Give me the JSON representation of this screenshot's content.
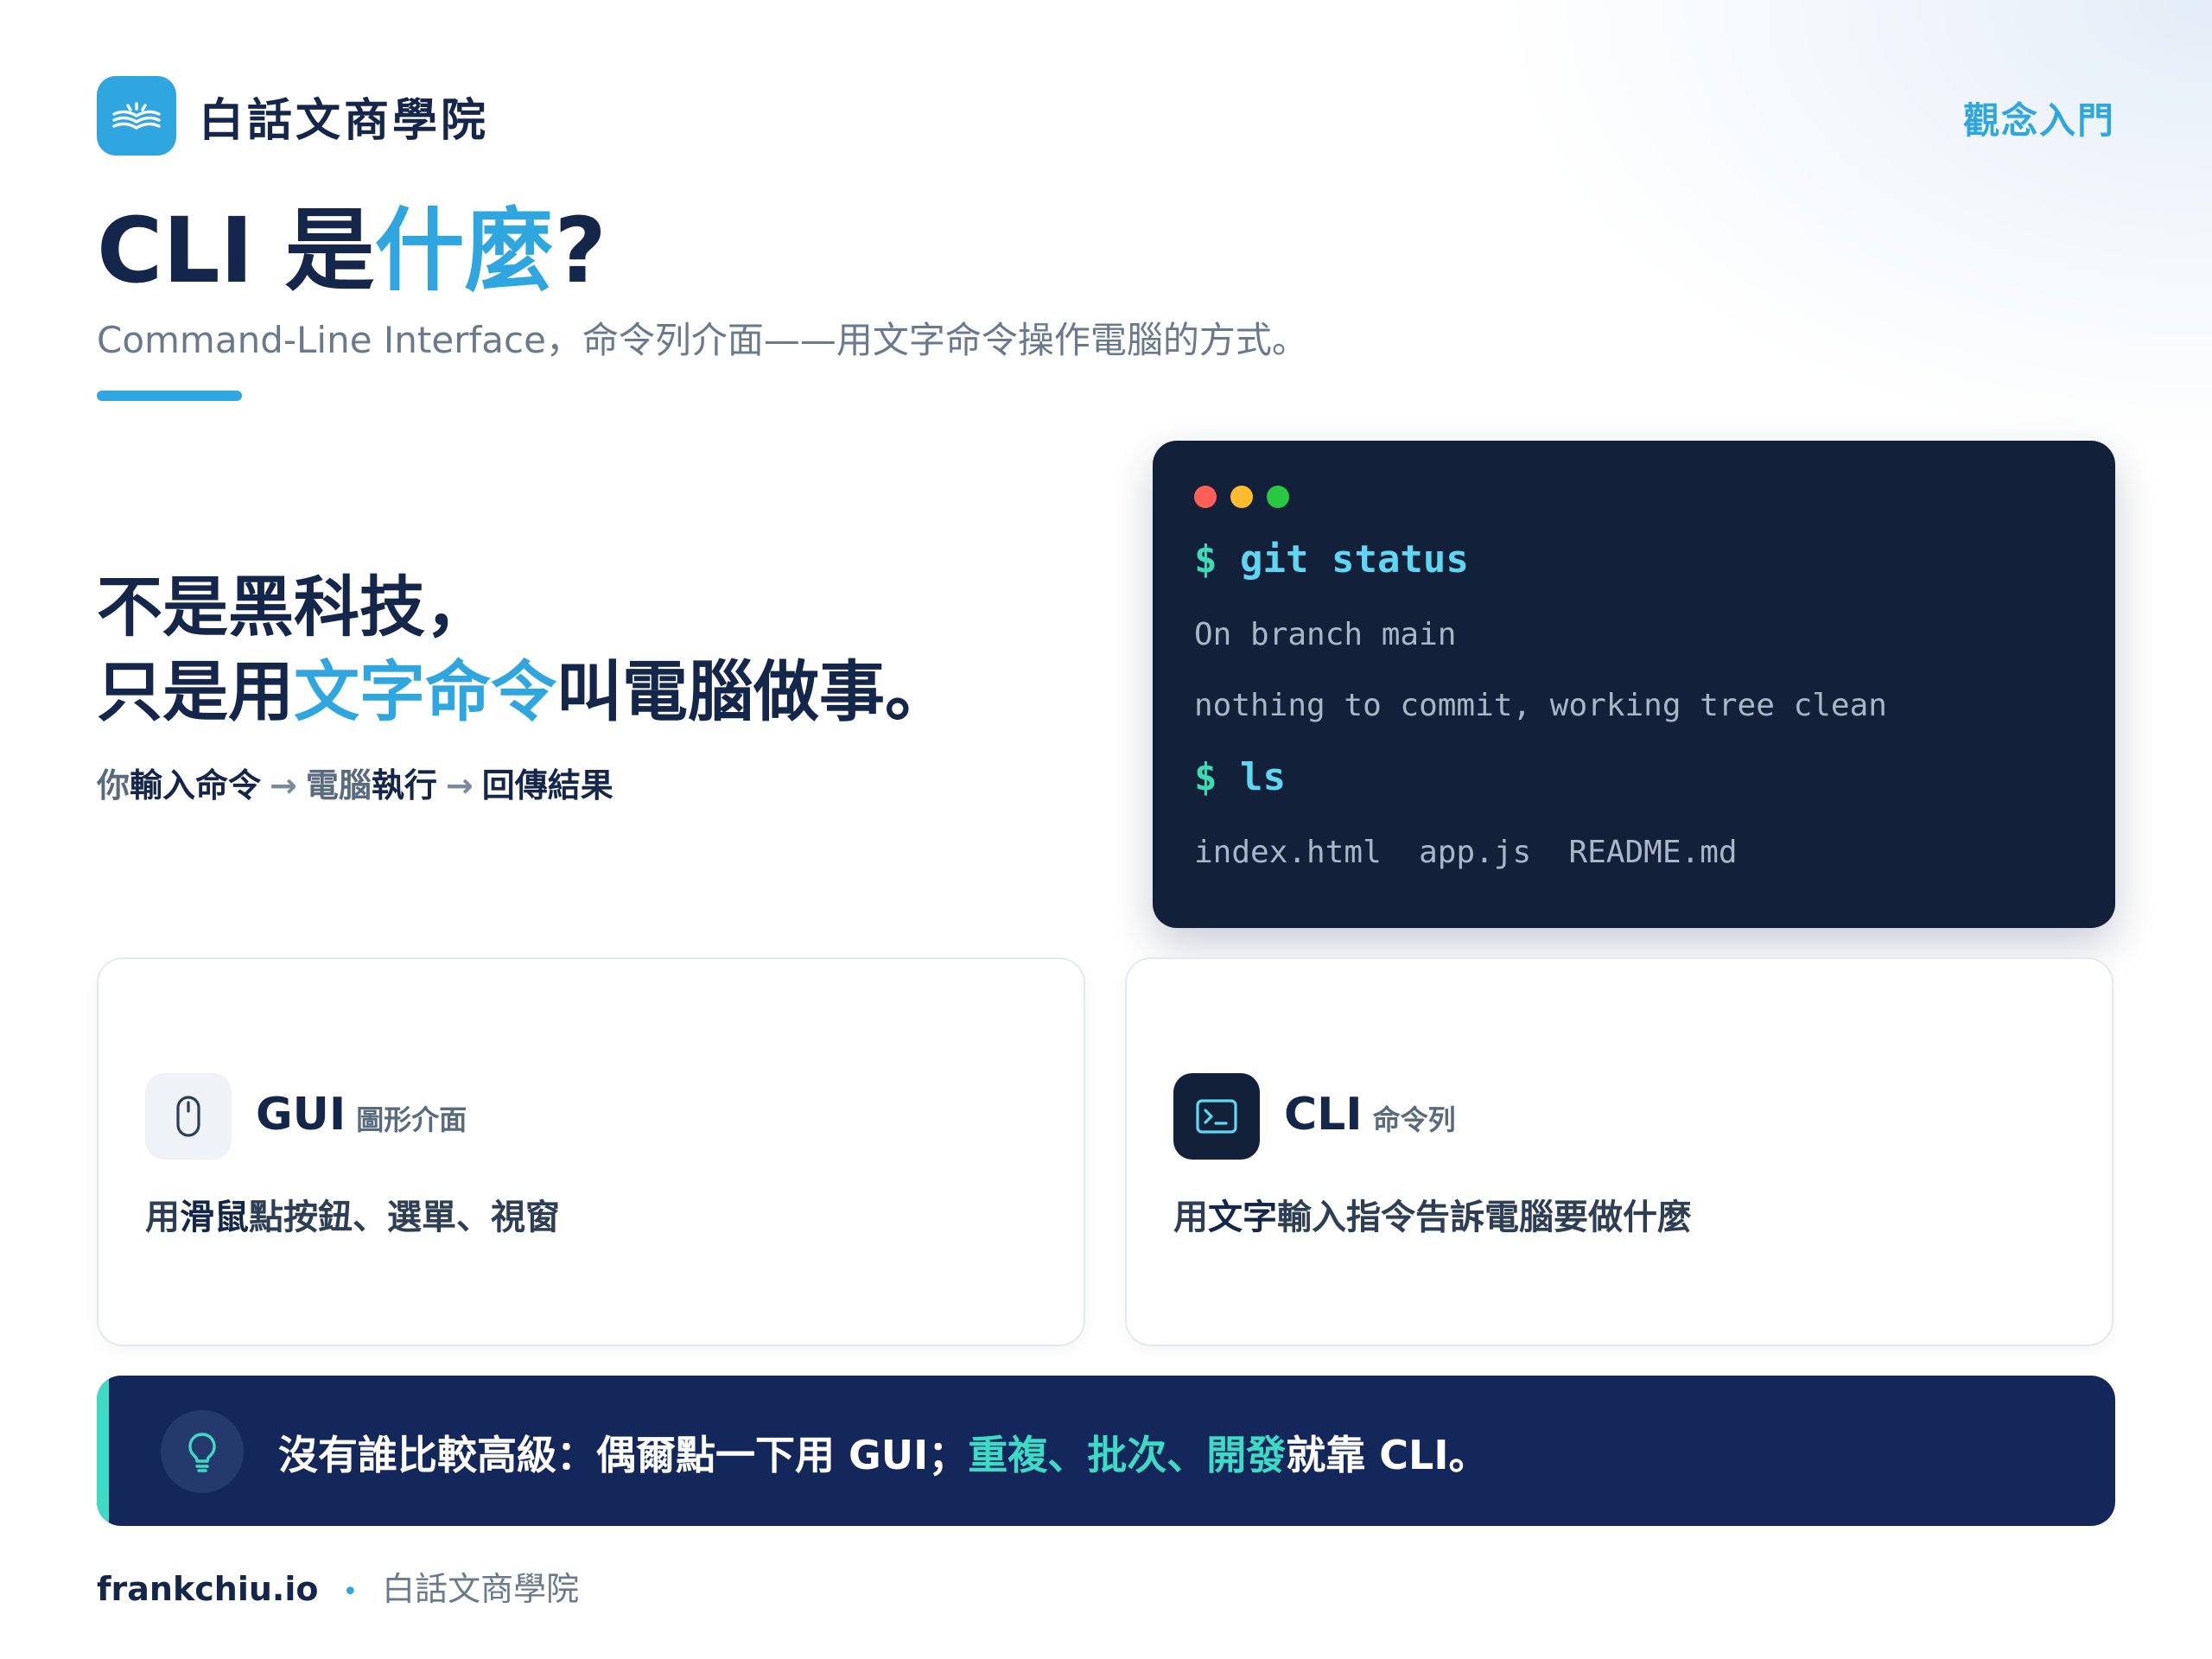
{
  "header": {
    "brand_name": "白話文商學院",
    "category": "觀念入門",
    "logo_icon": "open-book-logo-icon"
  },
  "title": {
    "prefix": "CLI 是",
    "accent": "什麼",
    "suffix": "?",
    "subtitle": "Command-Line Interface，命令列介面——用文字命令操作電腦的方式。"
  },
  "hero": {
    "line1": "不是黑科技，",
    "line2_prefix": "只是用",
    "line2_accent": "文字命令",
    "line2_suffix": "叫電腦做事。",
    "flow": {
      "step1_muted": "你",
      "step1": "輸入命令",
      "arrow": "→",
      "step2_muted": "電腦",
      "step2": "執行",
      "step3": "回傳結果"
    }
  },
  "terminal": {
    "dot_colors": [
      "#ff5f57",
      "#febc2e",
      "#28c840"
    ],
    "prompt": "$",
    "lines": [
      {
        "kind": "cmd",
        "text": "git status"
      },
      {
        "kind": "out",
        "text": "On branch main"
      },
      {
        "kind": "out",
        "text": "nothing to commit, working tree clean"
      },
      {
        "kind": "cmd",
        "text": "ls"
      },
      {
        "kind": "out",
        "text": "index.html  app.js  README.md"
      }
    ]
  },
  "cards": {
    "gui": {
      "icon": "mouse-icon",
      "title": "GUI",
      "tag": "圖形介面",
      "desc_prefix": "用",
      "desc_strong": "滑鼠",
      "desc_suffix": "點按鈕、選單、視窗"
    },
    "cli": {
      "icon": "terminal-icon",
      "title": "CLI",
      "tag": "命令列",
      "desc_prefix": "用",
      "desc_strong": "文字",
      "desc_suffix": "輸入指令告訴電腦要做什麼"
    }
  },
  "callout": {
    "icon": "lightbulb-icon",
    "text_prefix": "沒有誰比較高級：偶爾點一下用 GUI；",
    "hl1": "重複",
    "sep1": "、",
    "hl2": "批次",
    "sep2": "、",
    "hl3": "開發",
    "text_suffix": "就靠 CLI。"
  },
  "footer": {
    "site": "frankchiu.io",
    "separator": "•",
    "brand": "白話文商學院"
  },
  "colors": {
    "accent_blue": "#2fa6df",
    "navy": "#14264a",
    "terminal_bg": "#13203a",
    "callout_bg": "#13275a",
    "teal": "#3ddbc5"
  }
}
